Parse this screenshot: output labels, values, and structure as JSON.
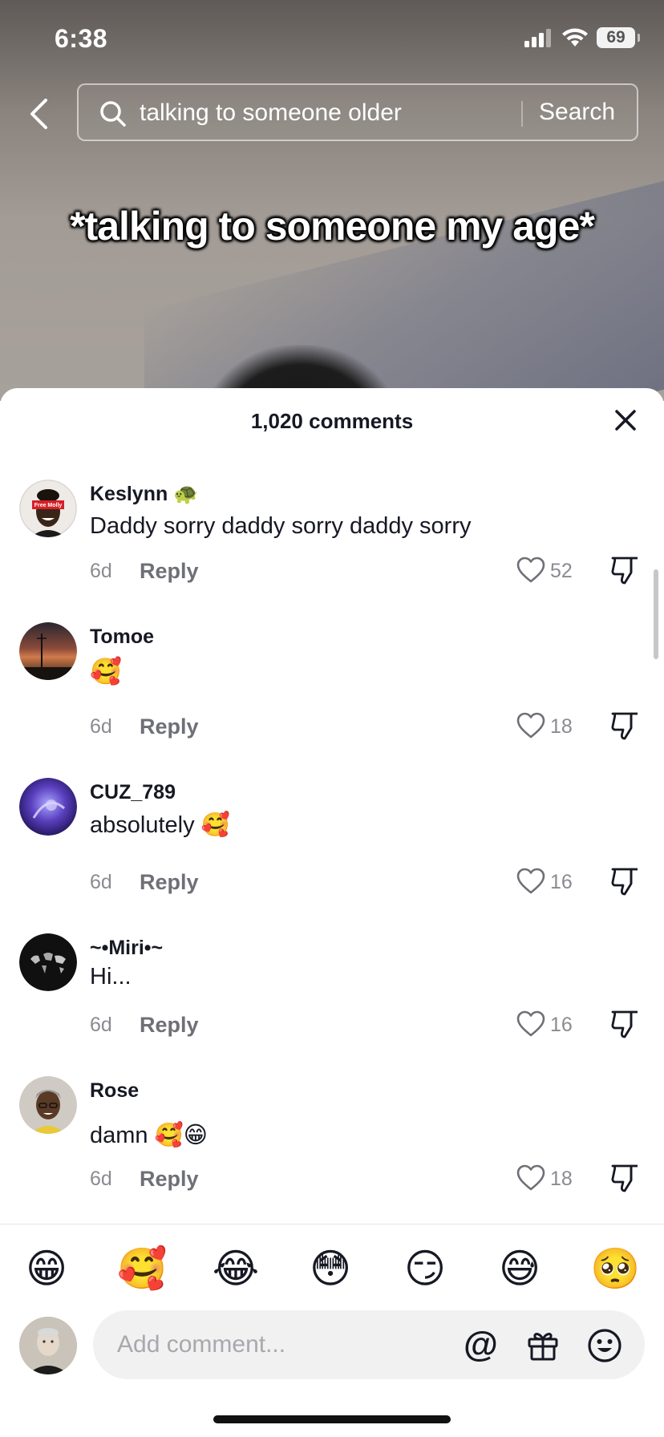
{
  "status_bar": {
    "time": "6:38",
    "battery": "69"
  },
  "search": {
    "query": "talking to someone older",
    "button_label": "Search"
  },
  "video": {
    "caption": "*talking to someone my age*"
  },
  "comments_sheet": {
    "title": "1,020 comments",
    "comments": [
      {
        "username": "Keslynn 🐢",
        "text": "Daddy sorry daddy sorry daddy sorry",
        "age": "6d",
        "reply_label": "Reply",
        "likes": "52"
      },
      {
        "username": "Tomoe",
        "text": "🥰",
        "age": "6d",
        "reply_label": "Reply",
        "likes": "18"
      },
      {
        "username": "CUZ_789",
        "text": "absolutely 🥰",
        "age": "6d",
        "reply_label": "Reply",
        "likes": "16"
      },
      {
        "username": "~•Miri•~",
        "text": "Hi...",
        "age": "6d",
        "reply_label": "Reply",
        "likes": "16"
      },
      {
        "username": "Rose",
        "text": "damn 🥰😁",
        "age": "6d",
        "reply_label": "Reply",
        "likes": "18"
      }
    ]
  },
  "quick_emojis": [
    "😁",
    "🥰",
    "😂",
    "😳",
    "😏",
    "😅",
    "🥺"
  ],
  "composer": {
    "placeholder": "Add comment...",
    "mention_symbol": "@"
  },
  "avatar_badge": "Free Molly",
  "icons": [
    "back-arrow",
    "search",
    "close",
    "heart-outline",
    "thumbs-down-outline",
    "gift",
    "smiley"
  ]
}
